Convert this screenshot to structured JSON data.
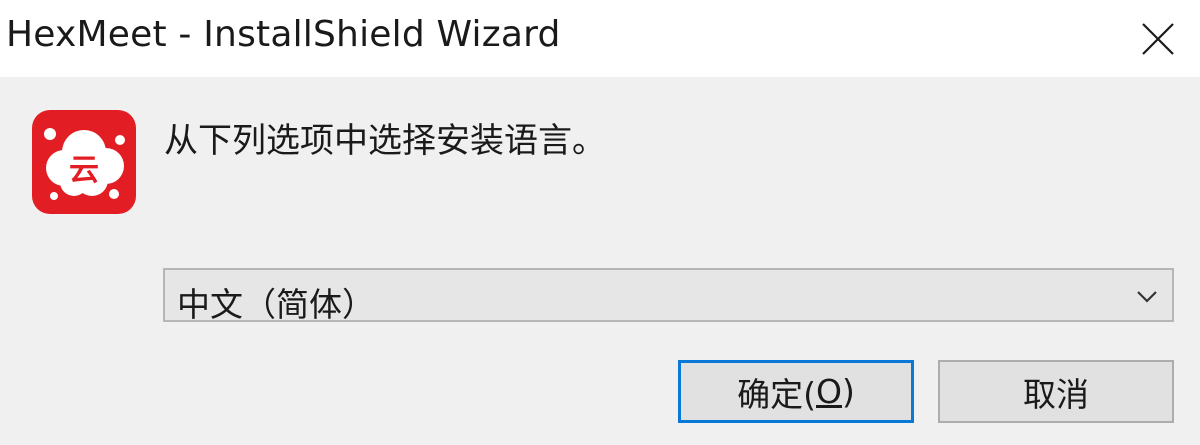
{
  "window": {
    "title": "HexMeet - InstallShield Wizard"
  },
  "icons": {
    "close": "close-icon",
    "app": "hexmeet-cloud-icon",
    "chevron": "chevron-down-icon",
    "app_logo_char": "云"
  },
  "dialog": {
    "prompt": "从下列选项中选择安装语言。",
    "language_selected": "中文（简体）"
  },
  "buttons": {
    "ok_prefix": "确定(",
    "ok_accel": "O",
    "ok_suffix": ")",
    "cancel": "取消"
  },
  "colors": {
    "accent": "#0a78d7",
    "logo_red": "#e31d24",
    "window_bg": "#f0f0f0",
    "titlebar_bg": "#ffffff"
  }
}
